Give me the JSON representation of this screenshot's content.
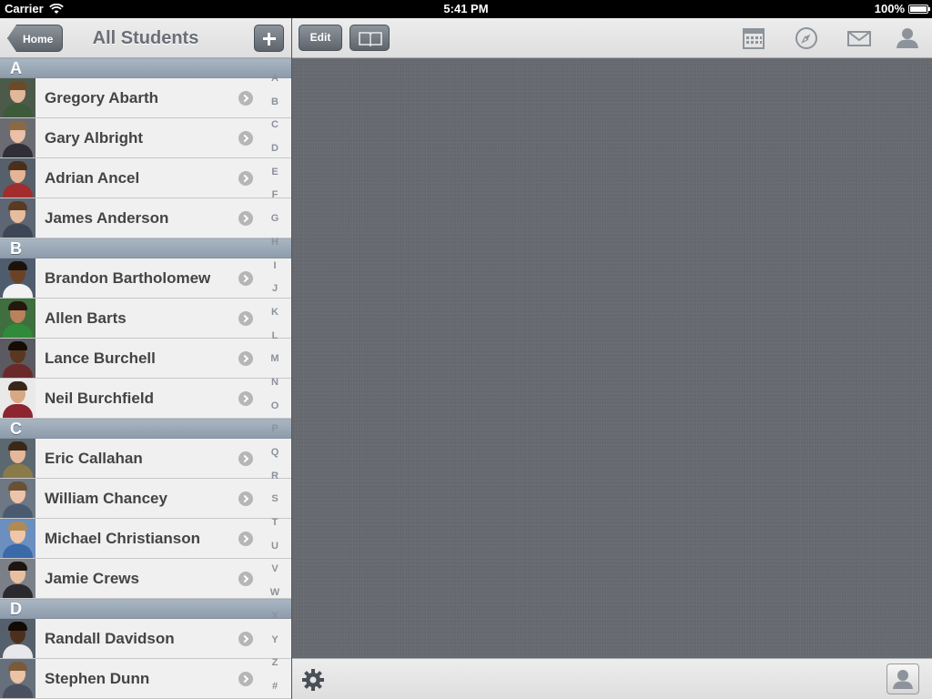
{
  "status_bar": {
    "carrier": "Carrier",
    "time": "5:41 PM",
    "battery": "100%"
  },
  "master": {
    "back_label": "Home",
    "title": "All Students",
    "add_icon": "plus-icon",
    "sections": [
      {
        "letter": "A",
        "students": [
          {
            "name": "Gregory Abarth",
            "bg": "#4c5a4a",
            "skin": "#e2b79a",
            "hair": "#6b4a2a",
            "shirt": "#3d5a3a"
          },
          {
            "name": "Gary Albright",
            "bg": "#6b6b72",
            "skin": "#ebc0a6",
            "hair": "#8a6a45",
            "shirt": "#2f2f35"
          },
          {
            "name": "Adrian Ancel",
            "bg": "#55606a",
            "skin": "#e6b494",
            "hair": "#4a2f1c",
            "shirt": "#a32c2c"
          },
          {
            "name": "James Anderson",
            "bg": "#5d6672",
            "skin": "#e8bc9f",
            "hair": "#5a3a22",
            "shirt": "#3c4654"
          }
        ]
      },
      {
        "letter": "B",
        "students": [
          {
            "name": "Brandon Bartholomew",
            "bg": "#4e5c6e",
            "skin": "#6b4226",
            "hair": "#1d120a",
            "shirt": "#f2f2f2"
          },
          {
            "name": "Allen Barts",
            "bg": "#3f6e3f",
            "skin": "#b9825a",
            "hair": "#24170e",
            "shirt": "#2f8a3a"
          },
          {
            "name": "Lance Burchell",
            "bg": "#5a5a60",
            "skin": "#5b3620",
            "hair": "#140b05",
            "shirt": "#6b2a2a"
          },
          {
            "name": "Neil Burchfield",
            "bg": "#e9e9e9",
            "skin": "#d8a784",
            "hair": "#3a2618",
            "shirt": "#8c2530"
          }
        ]
      },
      {
        "letter": "C",
        "students": [
          {
            "name": "Eric Callahan",
            "bg": "#5c6870",
            "skin": "#e4b899",
            "hair": "#3b2818",
            "shirt": "#8a7a4a"
          },
          {
            "name": "William Chancey",
            "bg": "#6e7884",
            "skin": "#eec4a8",
            "hair": "#6a5034",
            "shirt": "#4a5a70"
          },
          {
            "name": "Michael Christianson",
            "bg": "#6b8fbf",
            "skin": "#f0c6a8",
            "hair": "#b08a55",
            "shirt": "#3a6aa8"
          },
          {
            "name": "Jamie Crews",
            "bg": "#7b8088",
            "skin": "#e8c0a0",
            "hair": "#1e1410",
            "shirt": "#2a2a2e"
          }
        ]
      },
      {
        "letter": "D",
        "students": [
          {
            "name": "Randall Davidson",
            "bg": "#56606c",
            "skin": "#4e2f1b",
            "hair": "#120a05",
            "shirt": "#e8e8ec"
          },
          {
            "name": "Stephen Dunn",
            "bg": "#66707c",
            "skin": "#ecc2a4",
            "hair": "#7a5a3a",
            "shirt": "#4a5060"
          }
        ]
      }
    ],
    "index_letters": [
      "A",
      "B",
      "C",
      "D",
      "E",
      "F",
      "G",
      "H",
      "I",
      "J",
      "K",
      "L",
      "M",
      "N",
      "O",
      "P",
      "Q",
      "R",
      "S",
      "T",
      "U",
      "V",
      "W",
      "X",
      "Y",
      "Z",
      "#"
    ]
  },
  "detail": {
    "edit_label": "Edit",
    "book_icon": "book-icon",
    "nav_icons": [
      "calendar-icon",
      "compass-icon",
      "mail-icon",
      "person-icon"
    ],
    "toolbar_icons": [
      "gear-icon",
      "contact-card-icon"
    ]
  }
}
